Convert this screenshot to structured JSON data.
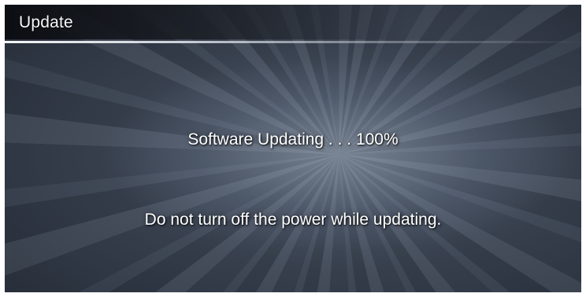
{
  "header": {
    "title": "Update"
  },
  "status": {
    "progress_label": "Software Updating . . . 100%",
    "progress_percent": 100,
    "warning": "Do not turn off the power while updating."
  },
  "colors": {
    "text": "#ffffff",
    "background_dark": "#232a35",
    "background_light": "#5a6677"
  }
}
